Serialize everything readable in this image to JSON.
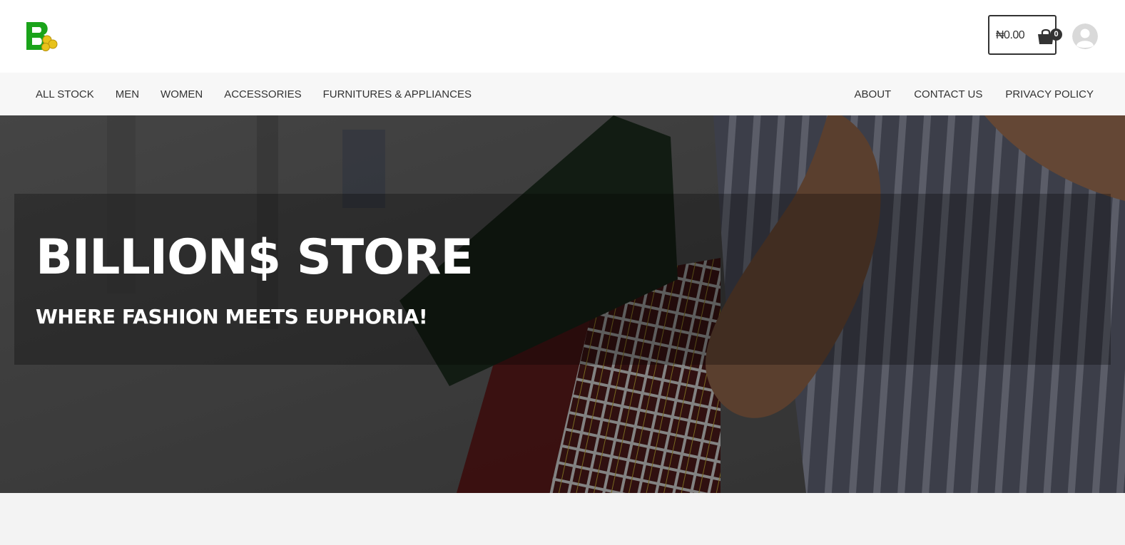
{
  "header": {
    "cart_amount": "₦0.00",
    "cart_count": "0"
  },
  "nav": {
    "left": [
      "ALL STOCK",
      "MEN",
      "WOMEN",
      "ACCESSORIES",
      "FURNITURES & APPLIANCES"
    ],
    "right": [
      "ABOUT",
      "CONTACT US",
      "PRIVACY POLICY"
    ]
  },
  "hero": {
    "title": "BILLION$ STORE",
    "subtitle": "WHERE FASHION MEETS EUPHORIA!"
  },
  "colors": {
    "logo_green": "#1aa31a",
    "logo_gold": "#e8c21a",
    "text_dark": "#333333",
    "nav_bg": "#f7f7f7",
    "page_bg": "#f3f3f3"
  },
  "icons": {
    "cart": "shopping-basket-icon",
    "avatar": "user-avatar-icon"
  }
}
